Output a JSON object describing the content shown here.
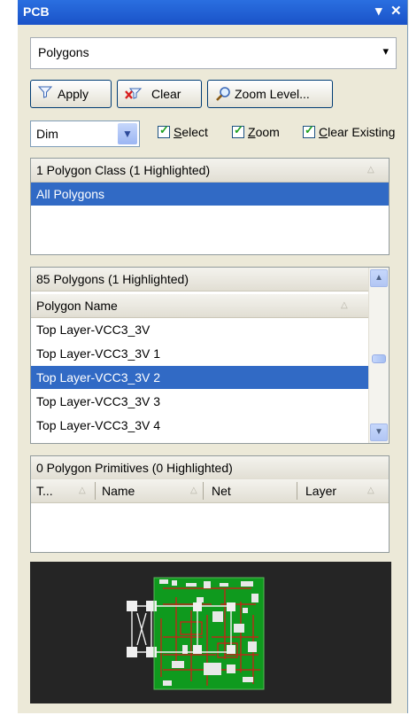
{
  "window": {
    "title": "PCB",
    "dropdown_glyph": "▾",
    "close_glyph": "✕"
  },
  "object_type": {
    "value": "Polygons",
    "arrow": "▾"
  },
  "toolbar": {
    "apply_label": "Apply",
    "clear_label": "Clear",
    "zoom_label": "Zoom Level..."
  },
  "mask": {
    "mode": "Dim",
    "select_label": "elect",
    "select_key": "S",
    "zoom_label": "oom",
    "zoom_key": "Z",
    "clear_existing_label": "lear Existing",
    "clear_existing_key": "C",
    "select_checked": true,
    "zoom_checked": true,
    "clear_existing_checked": true
  },
  "classes": {
    "header": "1 Polygon Class (1 Highlighted)",
    "rows": [
      "All Polygons"
    ],
    "selected_index": 0
  },
  "polygons": {
    "header": "85 Polygons (1 Highlighted)",
    "column": "Polygon Name",
    "rows": [
      "Top Layer-VCC3_3V",
      "Top Layer-VCC3_3V 1",
      "Top Layer-VCC3_3V 2",
      "Top Layer-VCC3_3V 3",
      "Top Layer-VCC3_3V 4"
    ],
    "selected_index": 2
  },
  "primitives": {
    "header": "0 Polygon Primitives (0 Highlighted)",
    "columns": [
      "T...",
      "Name",
      "Net",
      "Layer"
    ]
  },
  "colors": {
    "title_bar": "#1f5fd6",
    "selection": "#316ac5",
    "panel": "#ece9d8",
    "board_green": "#0f9a1e",
    "preview_bg": "#252525"
  }
}
